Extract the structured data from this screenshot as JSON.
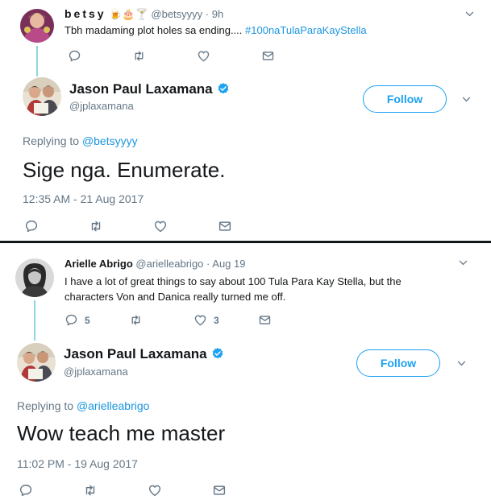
{
  "shot1": {
    "reply": {
      "name": "betsy",
      "emoji": "🍺🎂🍸",
      "handle": "@betsyyyy",
      "time": "· 9h",
      "text": "Tbh madaming plot holes sa ending.... ",
      "hashtag": "#100naTulaParaKayStella"
    },
    "main": {
      "name": "Jason Paul Laxamana",
      "handle": "@jplaxamana",
      "follow_label": "Follow",
      "replying_prefix": "Replying to ",
      "replying_handle": "@betsyyyy",
      "text": "Sige nga. Enumerate.",
      "timestamp": "12:35 AM - 21 Aug 2017"
    }
  },
  "shot2": {
    "reply": {
      "name": "Arielle Abrigo",
      "handle": "@arielleabrigo",
      "time": "· Aug 19",
      "text_line1": "I have a lot of great things to say about 100 Tula Para Kay Stella, but the",
      "text_line2": "characters Von and Danica really turned me off.",
      "reply_count": "5",
      "like_count": "3"
    },
    "main": {
      "name": "Jason Paul Laxamana",
      "handle": "@jplaxamana",
      "follow_label": "Follow",
      "replying_prefix": "Replying to ",
      "replying_handle": "@arielleabrigo",
      "text": "Wow teach me master",
      "timestamp": "11:02 PM - 19 Aug 2017"
    }
  },
  "icons": [
    "reply-icon",
    "retweet-icon",
    "like-icon",
    "message-icon",
    "chevron-down-icon",
    "verified-icon"
  ],
  "colors": {
    "accent": "#1da1f2",
    "link": "#1b95e0",
    "muted": "#657786",
    "thread": "#8ed6e0"
  }
}
